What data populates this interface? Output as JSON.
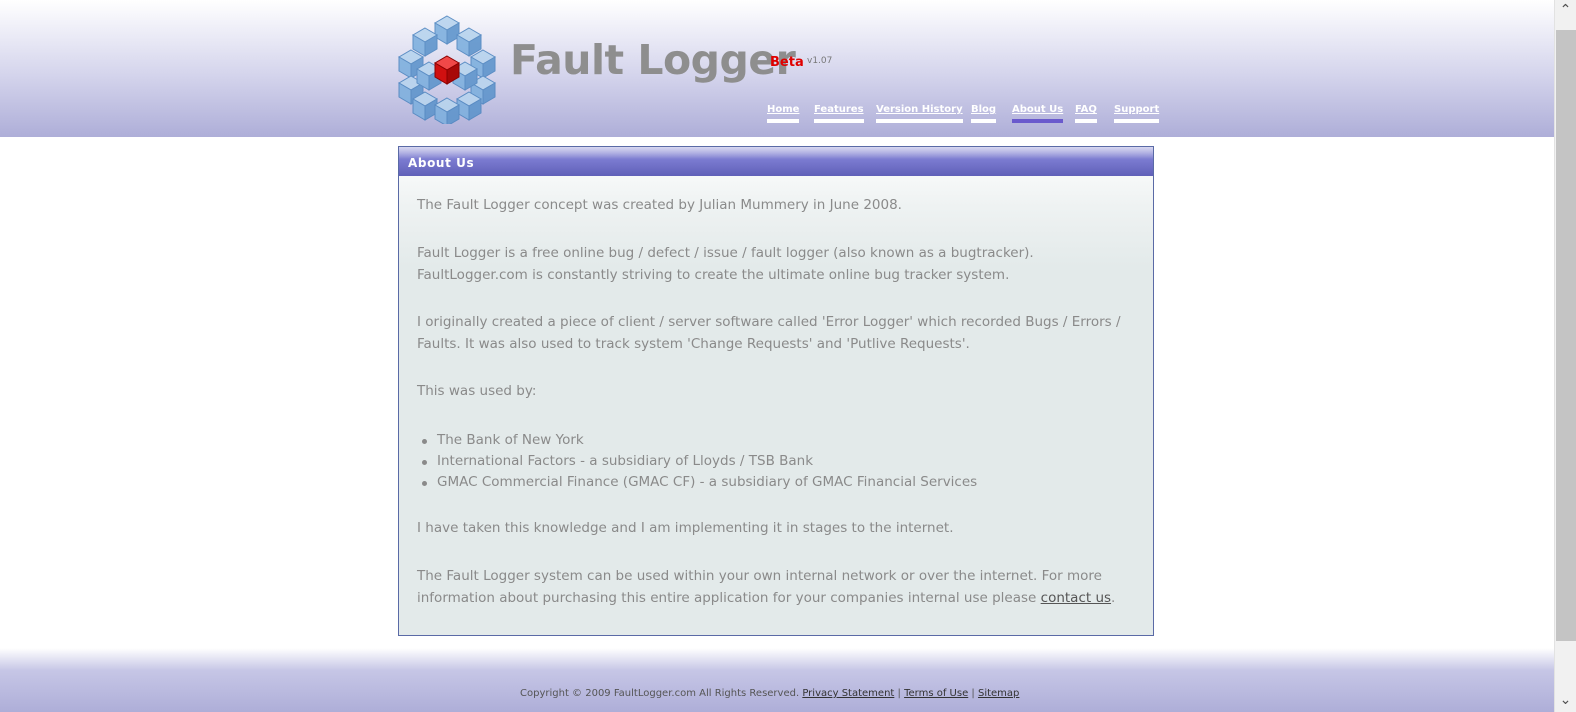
{
  "header": {
    "brand_name": "Fault Logger",
    "beta_label": "Beta",
    "version": "v1.07",
    "nav": [
      {
        "label": "Home",
        "active": false
      },
      {
        "label": "Features",
        "active": false
      },
      {
        "label": "Version History",
        "active": false
      },
      {
        "label": "Blog",
        "active": false
      },
      {
        "label": "About Us",
        "active": true
      },
      {
        "label": "FAQ",
        "active": false
      },
      {
        "label": "Support",
        "active": false
      }
    ]
  },
  "panel": {
    "title": "About Us",
    "para1": "The Fault Logger concept was created by Julian Mummery in June 2008.",
    "para2_line1": "Fault Logger is a free online bug / defect / issue / fault logger (also known as a bugtracker).",
    "para2_line2": "FaultLogger.com is constantly striving to create the ultimate online bug tracker system.",
    "para3_line1": "I originally created a piece of client / server software called 'Error Logger' which recorded Bugs / Errors /",
    "para3_line2": "Faults. It was also used to track system 'Change Requests' and 'Putlive Requests'.",
    "para4": "This was used by:",
    "list": [
      "The Bank of New York",
      "International Factors - a subsidiary of Lloyds / TSB Bank",
      "GMAC Commercial Finance (GMAC CF) - a subsidiary of GMAC Financial Services"
    ],
    "para5": "I have taken this knowledge and I am implementing it in stages to the internet.",
    "para6_line1": "The Fault Logger system can be used within your own internal network or over the internet. For more",
    "para6_line2_prefix": "information about purchasing this entire application for your companies internal use please ",
    "contact_link": "contact us",
    "para6_suffix": "."
  },
  "footer": {
    "copyright": "Copyright © 2009 FaultLogger.com All Rights Reserved.",
    "links": [
      "Privacy Statement",
      "Terms of Use",
      "Sitemap"
    ],
    "separator": "|"
  },
  "colors": {
    "header_bottom": "#aeaed8",
    "panel_head": "#6060b8",
    "active_underline": "#6a5acd",
    "beta": "#e00000",
    "logo_cube_blue": "#6fa6d6",
    "logo_cube_red": "#d01010"
  },
  "icons": {
    "logo": "cube-cluster-logo",
    "scroll_up": "chevron-up-icon",
    "scroll_down": "chevron-down-icon"
  }
}
